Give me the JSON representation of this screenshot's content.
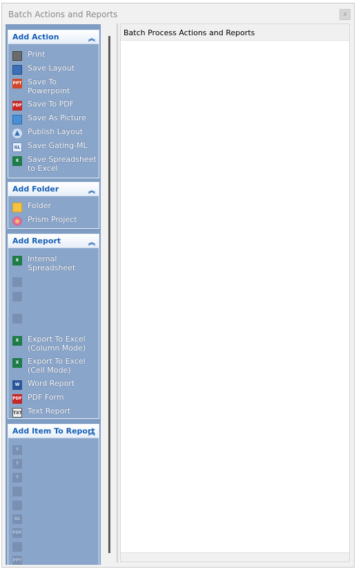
{
  "window": {
    "title": "Batch Actions and Reports",
    "close_label": "x"
  },
  "groups": [
    {
      "title": "Add Action",
      "items": [
        {
          "label": "Print",
          "icon": "printer-icon",
          "enabled": true
        },
        {
          "label": "Save Layout",
          "icon": "save-layout-icon",
          "enabled": true
        },
        {
          "label": "Save To Powerpoint",
          "icon": "powerpoint-icon",
          "enabled": true
        },
        {
          "label": "Save To PDF",
          "icon": "pdf-icon",
          "enabled": true
        },
        {
          "label": "Save As Picture",
          "icon": "picture-icon",
          "enabled": true
        },
        {
          "label": "Publish Layout",
          "icon": "publish-icon",
          "enabled": true
        },
        {
          "label": "Save Gating-ML",
          "icon": "gating-ml-icon",
          "enabled": true
        },
        {
          "label": "Save Spreadsheet to Excel",
          "icon": "excel-icon",
          "enabled": true
        }
      ]
    },
    {
      "title": "Add Folder",
      "items": [
        {
          "label": "Folder",
          "icon": "folder-icon",
          "enabled": true
        },
        {
          "label": "Prism Project",
          "icon": "prism-icon",
          "enabled": true
        }
      ]
    },
    {
      "title": "Add Report",
      "items": [
        {
          "label": "Internal Spreadsheet",
          "icon": "spreadsheet-icon",
          "enabled": true
        },
        {
          "label": "",
          "icon": "overlay-icon",
          "enabled": false
        },
        {
          "label": "",
          "icon": "bar-chart-icon",
          "enabled": false
        },
        {
          "label": "",
          "icon": "bar-chart-icon",
          "enabled": false
        },
        {
          "label": "Export To Excel (Column Mode)",
          "icon": "excel-icon",
          "enabled": true
        },
        {
          "label": "Export To Excel (Cell Mode)",
          "icon": "excel-icon",
          "enabled": true
        },
        {
          "label": "Word Report",
          "icon": "word-icon",
          "enabled": true
        },
        {
          "label": "PDF Form",
          "icon": "pdf-icon",
          "enabled": true
        },
        {
          "label": "Text Report",
          "icon": "text-icon",
          "enabled": true
        }
      ]
    },
    {
      "title": "Add Item To Report",
      "items": [
        {
          "label": "",
          "icon": "text-item-icon",
          "enabled": false
        },
        {
          "label": "",
          "icon": "text-item-icon",
          "enabled": false
        },
        {
          "label": "",
          "icon": "text-item-icon",
          "enabled": false
        },
        {
          "label": "",
          "icon": "image-item-icon",
          "enabled": false
        },
        {
          "label": "",
          "icon": "table-item-icon",
          "enabled": false
        },
        {
          "label": "",
          "icon": "gating-ml-icon",
          "enabled": false
        },
        {
          "label": "",
          "icon": "pdf-icon",
          "enabled": false
        },
        {
          "label": "",
          "icon": "picture-icon",
          "enabled": false
        },
        {
          "label": "",
          "icon": "powerpoint-icon",
          "enabled": false
        }
      ]
    }
  ],
  "right_pane": {
    "title": "Batch Process Actions and Reports"
  },
  "colors": {
    "accent": "#1660b7",
    "pane": "#8aa5ca"
  }
}
